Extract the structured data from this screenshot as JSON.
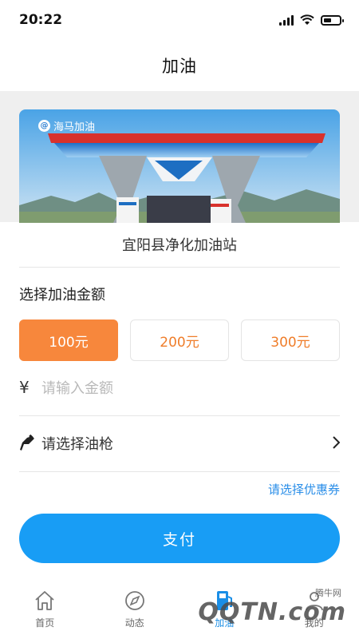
{
  "status_bar": {
    "time": "20:22"
  },
  "nav": {
    "title": "加油"
  },
  "banner": {
    "brand_text": "海马加油"
  },
  "station": {
    "name": "宜阳县净化加油站"
  },
  "amount_section": {
    "label": "选择加油金额",
    "options": [
      {
        "label": "100元",
        "selected": true
      },
      {
        "label": "200元",
        "selected": false
      },
      {
        "label": "300元",
        "selected": false
      }
    ]
  },
  "amount_input": {
    "currency_symbol": "¥",
    "placeholder": "请输入金额"
  },
  "nozzle": {
    "label": "请选择油枪"
  },
  "coupon": {
    "label": "请选择优惠券"
  },
  "pay_button": {
    "label": "支付"
  },
  "tabs": [
    {
      "label": "首页",
      "icon": "home-icon",
      "active": false
    },
    {
      "label": "动态",
      "icon": "compass-icon",
      "active": false
    },
    {
      "label": "加油",
      "icon": "fuel-pump-icon",
      "active": true
    },
    {
      "label": "我的",
      "icon": "person-icon",
      "active": false
    }
  ],
  "watermark": {
    "text": "腾牛网",
    "brand": "QQTN.com"
  },
  "colors": {
    "accent_orange": "#f7873c",
    "pay_blue": "#189df5",
    "link_blue": "#2a8ee8",
    "tab_active": "#1a8ee6"
  }
}
